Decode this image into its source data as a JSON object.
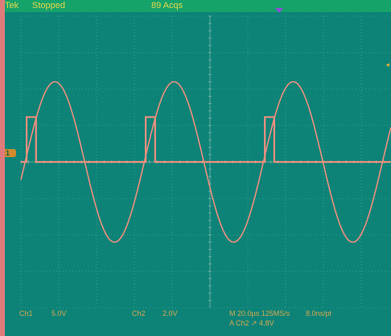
{
  "status_bar": {
    "brand": "Tek",
    "run_state": "Stopped",
    "acquisitions": "89 Acqs"
  },
  "channel_marker": "1",
  "trigger_level_marker": "◂",
  "readout": {
    "ch1_label": "Ch1",
    "ch1_scale": "5.0V",
    "ch2_label": "Ch2",
    "ch2_scale": "2.0V",
    "horizontal": "M 20.0µs 125MS/s",
    "sample_interval": "8.0ns/pt",
    "trigger": "A  Ch2  ↗  4.8V"
  },
  "colors": {
    "screen": "#0d8377",
    "bezel": "#df7b7b",
    "status_bar": "#15a36a",
    "trace": "#ee8f7f",
    "grid": "#7bb3ab",
    "label": "#d8a94f"
  },
  "chart_data": {
    "type": "line",
    "time_per_division_us": 20,
    "series": [
      {
        "name": "Ch1",
        "shape": "half-wave pulses",
        "volts_per_division": 5.0,
        "baseline_div": 0,
        "high_level_div": 1.23,
        "pulse_width_us": 5,
        "period_us": 63,
        "pulse_starts_us": [
          3,
          66,
          129
        ]
      },
      {
        "name": "Ch2",
        "shape": "sine",
        "volts_per_division": 2.0,
        "amplitude_div": 2.2,
        "offset_div": 0,
        "period_us": 63,
        "peak_times_us": [
          18,
          81,
          144
        ]
      }
    ]
  }
}
